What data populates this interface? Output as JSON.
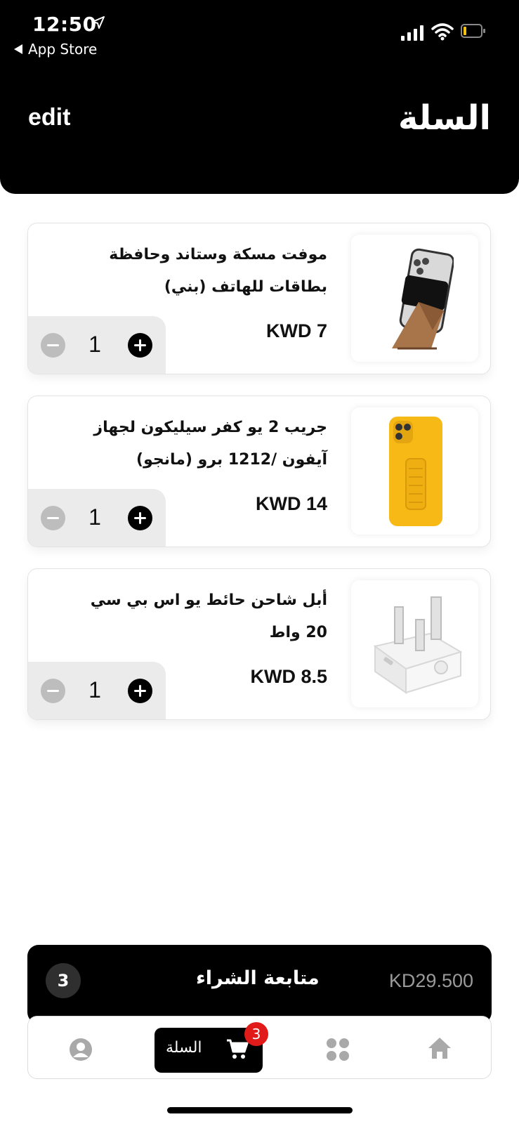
{
  "status_bar": {
    "time": "12:50",
    "back_app": "App Store"
  },
  "header": {
    "edit_label": "edit",
    "title": "السلة"
  },
  "cart_items": [
    {
      "name": "موفت مسكة وستاند وحافظة بطاقات للهاتف (بني)",
      "price": "KWD 7",
      "quantity": "1",
      "image": "phone-stand-wallet-image"
    },
    {
      "name": "جريب 2 يو كفر سيليكون لجهاز آيفون /1212 برو (مانجو)",
      "price": "KWD 14",
      "quantity": "1",
      "image": "yellow-phone-case-image"
    },
    {
      "name": "أبل شاحن حائط يو اس بي سي 20 واط",
      "price": "KWD 8.5",
      "quantity": "1",
      "image": "usb-c-charger-image"
    }
  ],
  "checkout": {
    "count": "3",
    "label": "متابعة الشراء",
    "total": "KD29.500"
  },
  "tabbar": {
    "cart_label": "السلة",
    "cart_badge": "3"
  },
  "icons": [
    "location-arrow-icon",
    "signal-icon",
    "wifi-icon",
    "battery-icon",
    "minus-icon",
    "plus-icon",
    "profile-icon",
    "cart-icon",
    "categories-icon",
    "home-icon"
  ],
  "colors": {
    "header_bg": "#000000",
    "badge_red": "#e11a1a",
    "total_gray": "#9a9a9a",
    "stepper_bg": "#ebebeb"
  }
}
